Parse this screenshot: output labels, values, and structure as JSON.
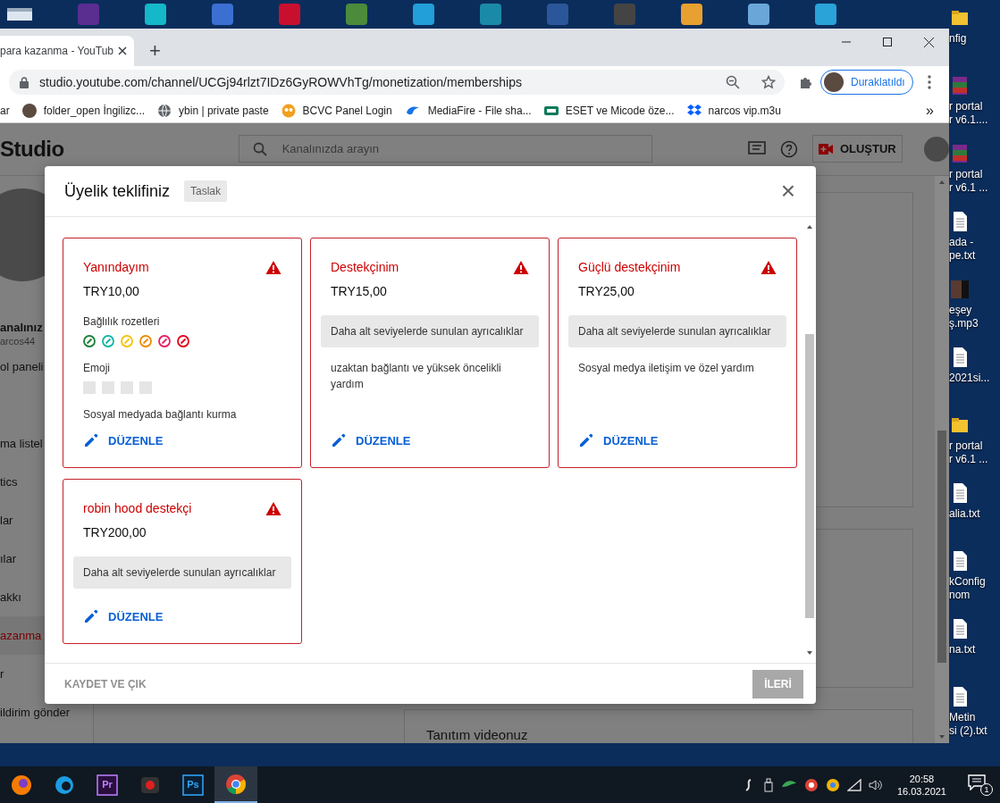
{
  "browser": {
    "tab": {
      "title": "para kazanma - YouTub",
      "selected": true
    },
    "new_tab": "+",
    "url": "studio.youtube.com/channel/UCGj94rlzt7IDz6GyROWVhTg/monetization/memberships",
    "profile": "Duraklatıldı",
    "bookmarks": [
      {
        "kind": "text",
        "label": "ar"
      },
      {
        "kind": "avatar",
        "label": "folder_open İngilizc..."
      },
      {
        "kind": "globe",
        "label": "ybin | private paste"
      },
      {
        "kind": "owl",
        "label": "BCVC Panel Login"
      },
      {
        "kind": "cloud",
        "label": "MediaFire - File sha..."
      },
      {
        "kind": "chip",
        "label": "ESET ve Micode öze..."
      },
      {
        "kind": "box",
        "label": "narcos vip.m3u"
      }
    ],
    "bookmarks_more": "»"
  },
  "studio": {
    "logo": "Studio",
    "search_placeholder": "Kanalınızda arayın",
    "create": "OLUŞTUR",
    "channel": {
      "name": "analınız",
      "handle": "arcos44"
    },
    "nav": [
      {
        "label": "ol paneli",
        "selected": false
      },
      {
        "label": "ma listel",
        "selected": false
      },
      {
        "label": "tics",
        "selected": false
      },
      {
        "label": "lar",
        "selected": false
      },
      {
        "label": "ılar",
        "selected": false
      },
      {
        "label": "akkı",
        "selected": false
      },
      {
        "label": "azanma",
        "selected": true
      },
      {
        "label": "r",
        "selected": false
      },
      {
        "label": "ildirim gönder",
        "selected": false
      }
    ],
    "promo_title": "Tanıtım videonuz"
  },
  "dialog": {
    "title": "Üyelik teklifiniz",
    "status": "Taslak",
    "close": "×",
    "tiers": [
      {
        "name": "Yanındayım",
        "price": "TRY10,00",
        "warning": true,
        "sections": [
          {
            "kind": "badges",
            "label": "Bağlılık rozetleri",
            "badges": [
              {
                "color": "#188038"
              },
              {
                "color": "#12b5a5"
              },
              {
                "color": "#f4c20d"
              },
              {
                "color": "#f08c00"
              },
              {
                "color": "#e91e63"
              },
              {
                "color": "#e5001a"
              }
            ]
          },
          {
            "kind": "emoji",
            "label": "Emoji"
          },
          {
            "kind": "text",
            "text": "Sosyal medyada bağlantı kurma"
          }
        ],
        "edit": "DÜZENLE"
      },
      {
        "name": "Destekçinim",
        "price": "TRY15,00",
        "warning": true,
        "sections": [
          {
            "kind": "inherited",
            "text": "Daha alt seviyelerde sunulan ayrıcalıklar"
          },
          {
            "kind": "text",
            "text": "uzaktan bağlantı ve yüksek öncelikli yardım"
          }
        ],
        "edit": "DÜZENLE"
      },
      {
        "name": "Güçlü destekçinim",
        "price": "TRY25,00",
        "warning": true,
        "sections": [
          {
            "kind": "inherited",
            "text": "Daha alt seviyelerde sunulan ayrıcalıklar"
          },
          {
            "kind": "text",
            "text": "Sosyal medya iletişim ve özel yardım"
          }
        ],
        "edit": "DÜZENLE"
      },
      {
        "name": "robin hood destekçi",
        "price": "TRY200,00",
        "warning": true,
        "sections": [
          {
            "kind": "inherited",
            "text": "Daha alt seviyelerde sunulan ayrıcalıklar"
          }
        ],
        "edit": "DÜZENLE"
      }
    ],
    "save_exit": "KAYDET VE ÇIK",
    "next": {
      "label": "İLERİ",
      "disabled": true
    }
  },
  "desktop_items": [
    {
      "kind": "config",
      "lines": [
        "nfig"
      ]
    },
    {
      "kind": "archive",
      "lines": [
        "r portal",
        "r v6.1...."
      ]
    },
    {
      "kind": "archive",
      "lines": [
        "r portal",
        "r v6.1 ..."
      ]
    },
    {
      "kind": "text",
      "lines": [
        "ada -",
        "pe.txt"
      ]
    },
    {
      "kind": "audio",
      "lines": [
        "eşey",
        "ş.mp3"
      ]
    },
    {
      "kind": "text",
      "lines": [
        "2021si..."
      ]
    },
    {
      "kind": "config",
      "lines": [
        "r portal",
        "r v6.1 ..."
      ]
    },
    {
      "kind": "text",
      "lines": [
        "alia.txt"
      ]
    },
    {
      "kind": "text",
      "lines": [
        "kConfig",
        "nom"
      ]
    },
    {
      "kind": "text",
      "lines": [
        "na.txt"
      ]
    },
    {
      "kind": "text",
      "lines": [
        "Metin",
        "si (2).txt"
      ]
    }
  ],
  "taskbar": {
    "apps": [
      {
        "kind": "firefox",
        "selected": false
      },
      {
        "kind": "edge",
        "selected": false
      },
      {
        "kind": "premiere",
        "label": "Pr",
        "selected": false
      },
      {
        "kind": "recorder",
        "selected": false
      },
      {
        "kind": "photoshop",
        "label": "Ps",
        "selected": false
      },
      {
        "kind": "chrome",
        "selected": true
      }
    ],
    "time": "20:58",
    "date": "16.03.2021",
    "notifications": "1"
  }
}
